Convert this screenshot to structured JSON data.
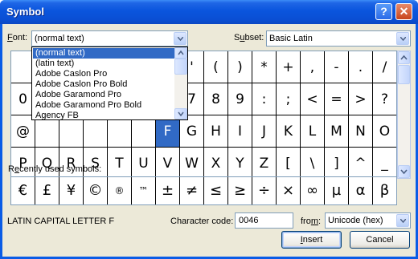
{
  "window": {
    "title": "Symbol",
    "help_label": "?",
    "close_label": "✕"
  },
  "font": {
    "label_prefix": "F",
    "label_rest": "ont:",
    "value": "(normal text)"
  },
  "subset": {
    "label_prefix": "S",
    "label_under": "u",
    "label_rest": "bset:",
    "value": "Basic Latin"
  },
  "font_dropdown": {
    "items": [
      "(normal text)",
      "(latin text)",
      "Adobe Caslon Pro",
      "Adobe Caslon Pro Bold",
      "Adobe Garamond Pro",
      "Adobe Garamond Pro Bold",
      "Agency FB"
    ],
    "selected_index": 0
  },
  "symbol_grid": {
    "rows": [
      [
        "",
        "",
        "",
        "",
        "",
        "",
        "",
        "'",
        "(",
        ")",
        "*",
        "+",
        ",",
        "-",
        ".",
        "/"
      ],
      [
        "0",
        "",
        "",
        "",
        "",
        "",
        "",
        "7",
        "8",
        "9",
        ":",
        ";",
        "<",
        "=",
        ">",
        "?"
      ],
      [
        "@",
        "",
        "",
        "",
        "",
        "",
        "F",
        "G",
        "H",
        "I",
        "J",
        "K",
        "L",
        "M",
        "N",
        "O"
      ],
      [
        "P",
        "Q",
        "R",
        "S",
        "T",
        "U",
        "V",
        "W",
        "X",
        "Y",
        "Z",
        "[",
        "\\",
        "]",
        "^",
        "_"
      ]
    ],
    "selected": "F"
  },
  "recent": {
    "label": "Recently used symbols:",
    "label_underline_index": 1,
    "symbols": [
      "€",
      "£",
      "¥",
      "©",
      "®",
      "™",
      "±",
      "≠",
      "≤",
      "≥",
      "÷",
      "×",
      "∞",
      "µ",
      "α",
      "β"
    ]
  },
  "char_name": "LATIN CAPITAL LETTER F",
  "char_code": {
    "label_prefix": "Character code: ",
    "value": "0046"
  },
  "from": {
    "label_prefix": "fro",
    "label_under": "m",
    "label_rest": ":",
    "value": "Unicode (hex)"
  },
  "buttons": {
    "insert": "Insert",
    "insert_under": "I",
    "cancel": "Cancel"
  }
}
